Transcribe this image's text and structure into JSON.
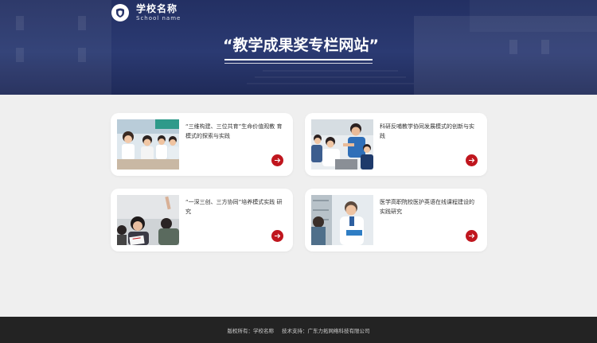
{
  "header": {
    "school_name": "学校名称",
    "school_name_en": "School name",
    "banner_title": "“教学成果奖专栏网站”"
  },
  "cards": [
    {
      "title": "“三维构建、三位共育”生命价值观教 育模式的探索与实践",
      "icon": "arrow-right-icon"
    },
    {
      "title": "科研反哺教学协同发展模式的创新与实 践",
      "icon": "arrow-right-icon"
    },
    {
      "title": "“一深三创、三方协同”培养模式实践 研究",
      "icon": "arrow-right-icon"
    },
    {
      "title": "医学高职院校医护英语在线课程建设的 实践研究",
      "icon": "arrow-right-icon"
    }
  ],
  "footer": {
    "copyright": "版权所有：学校名称",
    "support": "技术支持：广东力拓网络科技有限公司"
  },
  "colors": {
    "banner": "#28356a",
    "accent": "#c0161e",
    "background": "#efefef",
    "footer": "#232323"
  }
}
